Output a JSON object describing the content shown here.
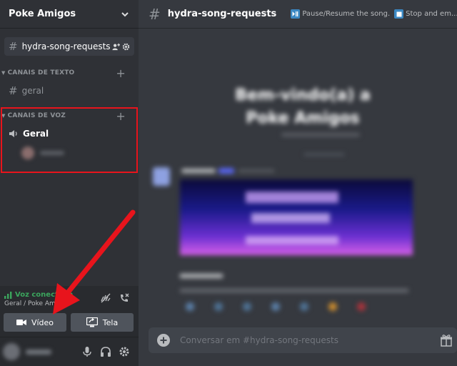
{
  "server": {
    "name": "Poke Amigos"
  },
  "sidebar": {
    "pinned_channel": "hydra-song-requests",
    "text_category": "CANAIS DE TEXTO",
    "text_channels": [
      "geral"
    ],
    "voice_category": "CANAIS DE VOZ",
    "voice_channels": [
      "Geral"
    ]
  },
  "voice_panel": {
    "status": "Voz conectada",
    "location": "Geral / Poke Amigos",
    "video_label": "Vídeo",
    "screen_label": "Tela"
  },
  "topbar": {
    "channel": "hydra-song-requests",
    "topics": [
      "Pause/Resume the song.",
      "Stop and em..."
    ]
  },
  "main": {
    "welcome_title": "Bem-vindo(a) a Poke Amigos"
  },
  "composer": {
    "placeholder": "Conversar em #hydra-song-requests"
  },
  "colors": {
    "accent_red": "#e8141c",
    "connected_green": "#3ba55d",
    "blurple": "#5865f2"
  },
  "icons": [
    "chevron-down-icon",
    "hash-icon",
    "add-member-icon",
    "gear-icon",
    "plus-icon",
    "speaker-icon",
    "signal-icon",
    "noise-suppression-icon",
    "disconnect-icon",
    "camera-icon",
    "screen-share-icon",
    "microphone-icon",
    "headphones-icon",
    "add-icon",
    "gift-icon",
    "play-pause-icon",
    "stop-icon"
  ]
}
